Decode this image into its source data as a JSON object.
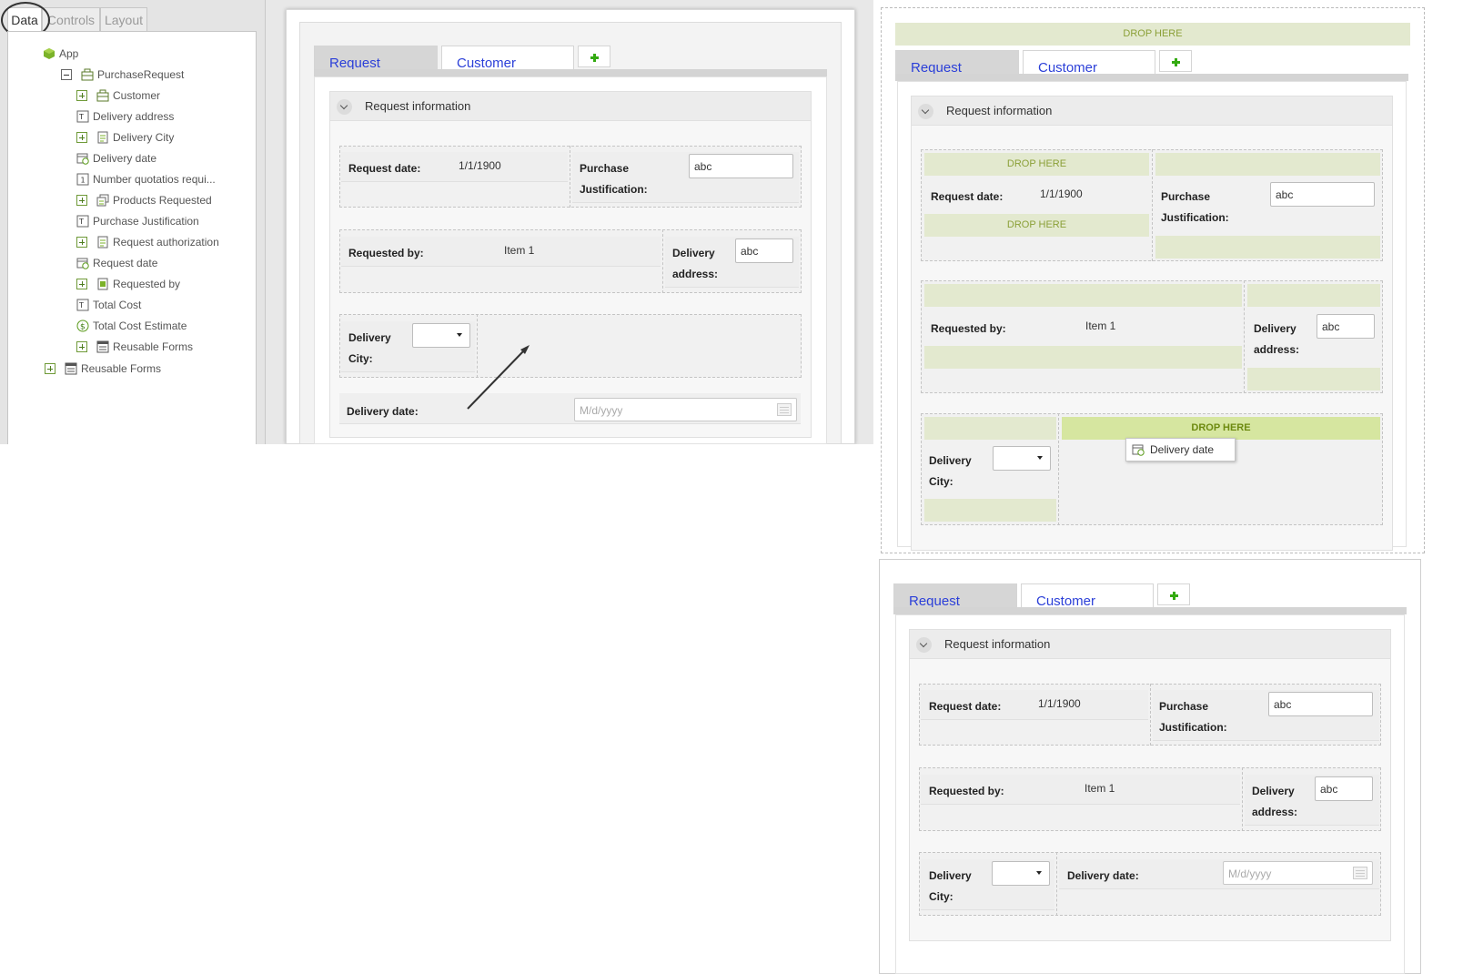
{
  "designer": {
    "tabs": [
      "Data",
      "Controls",
      "Layout"
    ],
    "tree": [
      {
        "label": "App",
        "icon": "app-cube-icon",
        "expander": "none"
      },
      {
        "label": "PurchaseRequest",
        "icon": "entity-icon",
        "expander": "minus"
      },
      {
        "label": "Customer",
        "icon": "entity-icon",
        "expander": "plus"
      },
      {
        "label": "Delivery address",
        "icon": "text-field-icon",
        "expander": "none"
      },
      {
        "label": "Delivery City",
        "icon": "list-field-icon",
        "expander": "plus"
      },
      {
        "label": "Delivery date",
        "icon": "date-field-icon",
        "expander": "none"
      },
      {
        "label": "Number quotatios requi...",
        "icon": "number-field-icon",
        "expander": "none"
      },
      {
        "label": "Products Requested",
        "icon": "collection-icon",
        "expander": "plus"
      },
      {
        "label": "Purchase Justification",
        "icon": "text-field-icon",
        "expander": "none"
      },
      {
        "label": "Request authorization",
        "icon": "list-field-icon",
        "expander": "plus"
      },
      {
        "label": "Request date",
        "icon": "date-field-icon",
        "expander": "none"
      },
      {
        "label": "Requested by",
        "icon": "user-field-icon",
        "expander": "plus"
      },
      {
        "label": "Total Cost",
        "icon": "text-field-icon",
        "expander": "none"
      },
      {
        "label": "Total Cost Estimate",
        "icon": "currency-icon",
        "expander": "none"
      },
      {
        "label": "Reusable Forms",
        "icon": "form-icon",
        "expander": "plus"
      },
      {
        "label": "Reusable Forms",
        "icon": "form-icon",
        "expander": "plus"
      }
    ]
  },
  "form": {
    "tabs": [
      "Request",
      "Customer"
    ],
    "section_title": "Request information",
    "fields": {
      "request_date_label": "Request date:",
      "request_date_value": "1/1/1900",
      "purchase_justification_label_1": "Purchase",
      "purchase_justification_label_2": "Justification:",
      "purchase_justification_value": "abc",
      "requested_by_label": "Requested by:",
      "requested_by_value": "Item 1",
      "delivery_address_label_1": "Delivery",
      "delivery_address_label_2": "address:",
      "delivery_address_value": "abc",
      "delivery_city_label_1": "Delivery",
      "delivery_city_label_2": "City:",
      "delivery_date_label": "Delivery date:",
      "delivery_date_placeholder": "M/d/yyyy"
    }
  },
  "drag": {
    "drop_here": "DROP HERE",
    "dragged_item": "Delivery date"
  },
  "colors": {
    "tab_link": "#2b3fd8",
    "drop_zone": "#e3e9cf",
    "drop_zone_active": "#d6e6a0",
    "add_tab_green": "#33aa10"
  }
}
